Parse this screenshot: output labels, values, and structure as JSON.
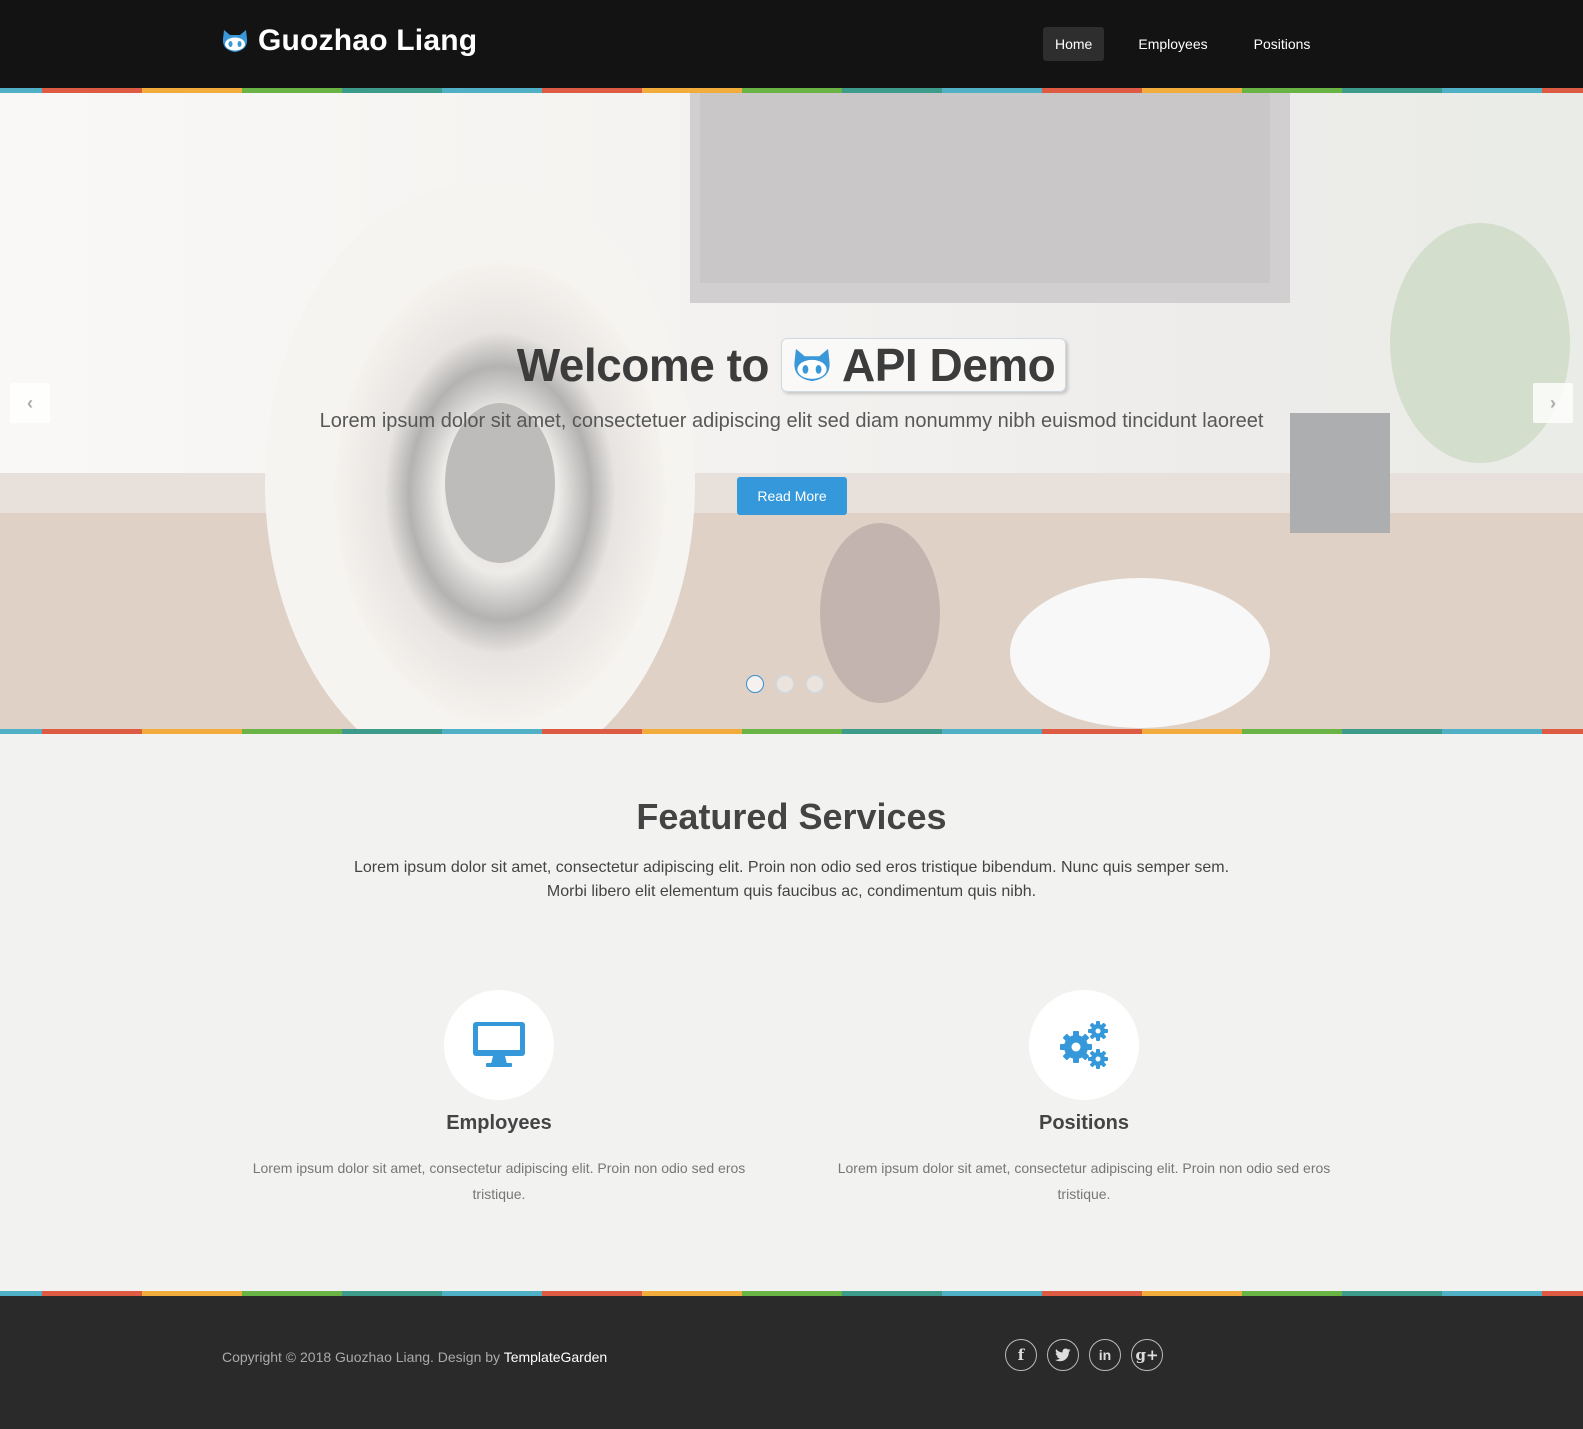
{
  "header": {
    "brand": "Guozhao Liang",
    "nav": [
      {
        "label": "Home",
        "active": true
      },
      {
        "label": "Employees",
        "active": false
      },
      {
        "label": "Positions",
        "active": false
      }
    ]
  },
  "hero": {
    "title_prefix": "Welcome to",
    "title_highlight": "API Demo",
    "subtitle": "Lorem ipsum dolor sit amet, consectetuer adipiscing elit sed diam nonummy nibh euismod tincidunt laoreet",
    "button": "Read More",
    "prev_arrow": "‹",
    "next_arrow": "›",
    "slide_count": 3,
    "active_slide": 1
  },
  "featured": {
    "title": "Featured Services",
    "text_line1": "Lorem ipsum dolor sit amet, consectetur adipiscing elit. Proin non odio sed eros tristique bibendum. Nunc quis semper sem.",
    "text_line2": "Morbi libero elit elementum quis faucibus ac, condimentum quis nibh.",
    "services": [
      {
        "icon": "desktop-icon",
        "title": "Employees",
        "text": "Lorem ipsum dolor sit amet, consectetur adipiscing elit. Proin non odio sed eros tristique."
      },
      {
        "icon": "cogs-icon",
        "title": "Positions",
        "text": "Lorem ipsum dolor sit amet, consectetur adipiscing elit. Proin non odio sed eros tristique."
      }
    ]
  },
  "footer": {
    "copyright_prefix": "Copyright © 2018 Guozhao Liang. Design by ",
    "designer": "TemplateGarden",
    "socials": [
      {
        "icon": "facebook-icon",
        "glyph": "f"
      },
      {
        "icon": "twitter-icon",
        "glyph": "t"
      },
      {
        "icon": "linkedin-icon",
        "glyph": "in"
      },
      {
        "icon": "google-plus-icon",
        "glyph": "g+"
      }
    ]
  },
  "colors": {
    "accent": "#3498db",
    "navbar": "#131313",
    "footer": "#2a2a2a",
    "stripe": [
      "#4fb0c6",
      "#dd5b43",
      "#f2ac3c",
      "#6ab345",
      "#3d9b8c"
    ]
  }
}
